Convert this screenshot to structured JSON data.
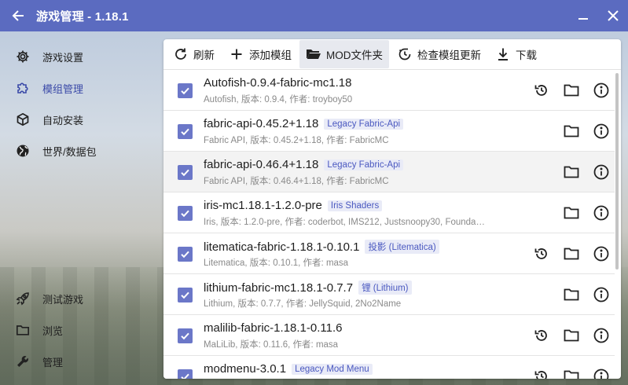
{
  "window": {
    "title": "游戏管理 - 1.18.1"
  },
  "sidebar": {
    "items": [
      {
        "label": "游戏设置",
        "icon": "gear-icon"
      },
      {
        "label": "模组管理",
        "icon": "puzzle-icon"
      },
      {
        "label": "自动安装",
        "icon": "package-icon"
      },
      {
        "label": "世界/数据包",
        "icon": "globe-icon"
      }
    ],
    "bottom_items": [
      {
        "label": "测试游戏",
        "icon": "rocket-icon"
      },
      {
        "label": "浏览",
        "icon": "folder-icon"
      },
      {
        "label": "管理",
        "icon": "wrench-icon"
      }
    ]
  },
  "toolbar": {
    "refresh": "刷新",
    "add_mod": "添加模组",
    "mod_folder": "MOD文件夹",
    "check_updates": "检查模组更新",
    "download": "下载"
  },
  "mods": [
    {
      "name": "Autofish-0.9.4-fabric-mc1.18",
      "tag": "",
      "desc": "Autofish, 版本: 0.9.4, 作者: troyboy50",
      "checked": true,
      "restore": true
    },
    {
      "name": "fabric-api-0.45.2+1.18",
      "tag": "Legacy Fabric-Api",
      "desc": "Fabric API, 版本: 0.45.2+1.18, 作者: FabricMC",
      "checked": true,
      "restore": false
    },
    {
      "name": "fabric-api-0.46.4+1.18",
      "tag": "Legacy Fabric-Api",
      "desc": "Fabric API, 版本: 0.46.4+1.18, 作者: FabricMC",
      "checked": true,
      "restore": false
    },
    {
      "name": "iris-mc1.18.1-1.2.0-pre",
      "tag": "Iris Shaders",
      "desc": "Iris, 版本: 1.2.0-pre, 作者: coderbot, IMS212, Justsnoopy30, Foundatio...",
      "checked": true,
      "restore": false
    },
    {
      "name": "litematica-fabric-1.18.1-0.10.1",
      "tag": "投影 (Litematica)",
      "desc": "Litematica, 版本: 0.10.1, 作者: masa",
      "checked": true,
      "restore": true
    },
    {
      "name": "lithium-fabric-mc1.18.1-0.7.7",
      "tag": "锂 (Lithium)",
      "desc": "Lithium, 版本: 0.7.7, 作者: JellySquid, 2No2Name",
      "checked": true,
      "restore": false
    },
    {
      "name": "malilib-fabric-1.18.1-0.11.6",
      "tag": "",
      "desc": "MaLiLib, 版本: 0.11.6, 作者: masa",
      "checked": true,
      "restore": true
    },
    {
      "name": "modmenu-3.0.1",
      "tag": "Legacy Mod Menu",
      "desc": "",
      "checked": true,
      "restore": true
    }
  ],
  "colors": {
    "accent": "#5b6bc0",
    "checkbox": "#6b77c8",
    "tag_text": "#4a58c0"
  }
}
